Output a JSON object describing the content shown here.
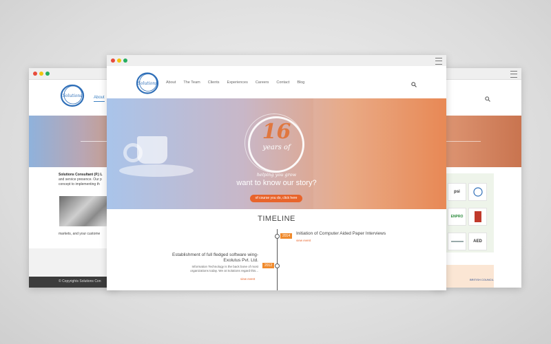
{
  "left_window": {
    "nav_about": "About",
    "intro_heading": "Solutions Consultant (P.) L",
    "intro_line1": "and service presence. Our p",
    "intro_line2": "concept to implementing th",
    "markets": "markets, and your custome",
    "copyright": "© Copyrights Solutions Con"
  },
  "right_window": {
    "client_logos": [
      "psi",
      "ENPRO",
      "AED"
    ],
    "british_council": "BRITISH COUNCIL"
  },
  "main_window": {
    "logo_text": "Solutions",
    "nav": [
      "About",
      "The Team",
      "Clients",
      "Experiences",
      "Careers",
      "Contact",
      "Blog"
    ],
    "hero": {
      "number": "16",
      "years": "years of",
      "tagline": "helping you grow",
      "headline": "want to know our story?",
      "cta": "of course you do, click here"
    },
    "timeline": {
      "title": "TIMELINE",
      "events": [
        {
          "year": "2014",
          "heading": "Initiation of Computer Aided Paper Interviews",
          "link": "view event"
        },
        {
          "year": "2012",
          "heading_line1": "Establishment of full fledged software wing-",
          "heading_line2": "Exolutus Pvt. Ltd.",
          "desc_line1": "Information Technology is the back bone of most",
          "desc_line2": "organizations today. We at Solutions regard this...",
          "link": "view event"
        }
      ]
    }
  },
  "colors": {
    "accent_orange": "#e8642b",
    "timeline_orange": "#f08a2c",
    "logo_blue": "#2f6fb8"
  }
}
